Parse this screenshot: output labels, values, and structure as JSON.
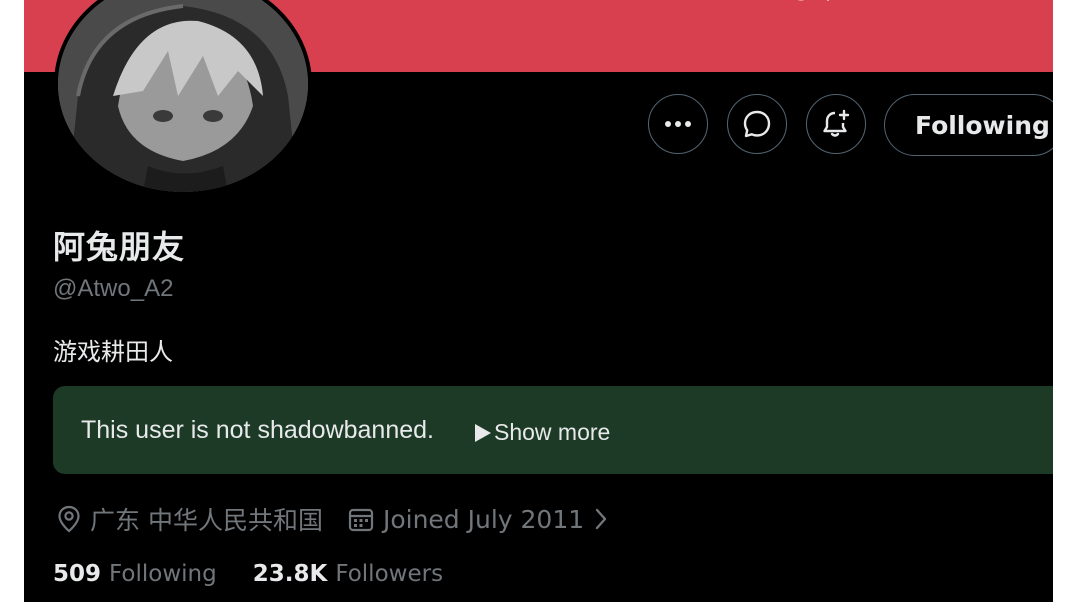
{
  "profile": {
    "display_name": "阿兔朋友",
    "handle": "@Atwo_A2",
    "bio": "游戏耕田人",
    "location": "广东 中华人民共和国",
    "joined": "Joined July 2011"
  },
  "actions": {
    "more_icon": "more-horizontal-icon",
    "message_icon": "message-bubble-icon",
    "notify_icon": "bell-plus-icon",
    "following_label": "Following"
  },
  "shadowban": {
    "status_text": "This user is not shadowbanned.",
    "show_more_label": "Show more"
  },
  "stats": {
    "following_count": "509",
    "following_label": "Following",
    "followers_count": "23.8K",
    "followers_label": "Followers"
  },
  "colors": {
    "banner": "#d8404f",
    "background": "#000000",
    "shadowban_box": "#1d3a26",
    "primary_text": "#e7e9ea",
    "secondary_text": "#71767b"
  }
}
